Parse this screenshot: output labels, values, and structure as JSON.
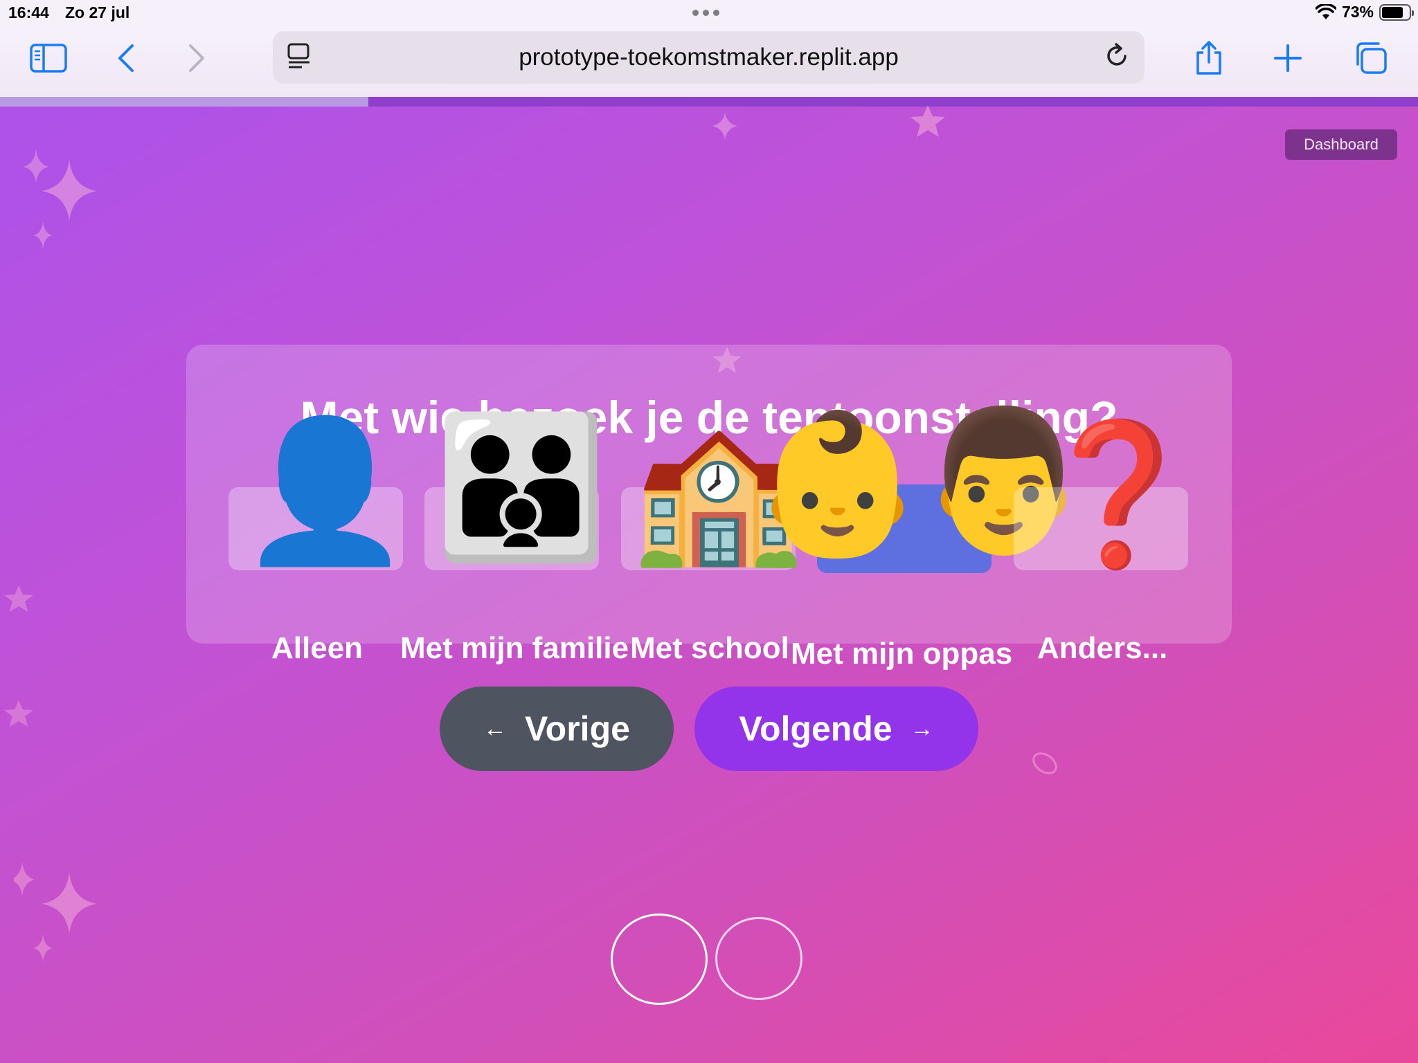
{
  "status_bar": {
    "time": "16:44",
    "date": "Zo 27 jul",
    "battery": "73%"
  },
  "browser": {
    "url": "prototype-toekomstmaker.replit.app",
    "icons": [
      "sidebar-icon",
      "back-icon",
      "forward-icon",
      "reader-icon",
      "reload-icon",
      "share-icon",
      "new-tab-icon",
      "tabs-icon"
    ]
  },
  "page": {
    "progress_fraction": 0.26,
    "dashboard_label": "Dashboard",
    "question": "Met wie bezoek je de tentoonstelling?",
    "options": [
      {
        "emoji": "👤",
        "label": "Alleen",
        "selected": false
      },
      {
        "emoji": "👪",
        "label": "Met mijn familie",
        "selected": false
      },
      {
        "emoji": "🏫",
        "label": "Met school",
        "selected": false
      },
      {
        "emoji": "👶",
        "label": "Met mijn oppas",
        "selected": true
      },
      {
        "emoji": "👨",
        "label": "",
        "selected": false
      },
      {
        "emoji": "❓",
        "label": "Anders...",
        "selected": false
      }
    ],
    "prev_label": "Vorige",
    "next_label": "Volgende",
    "prev_arrow": "←",
    "next_arrow": "→"
  },
  "colors": {
    "next_button": "#9333ea",
    "prev_button": "#4f5461",
    "selected_option": "#5e6fe0",
    "background_start": "#ad52ea",
    "background_end": "#e9489a"
  }
}
